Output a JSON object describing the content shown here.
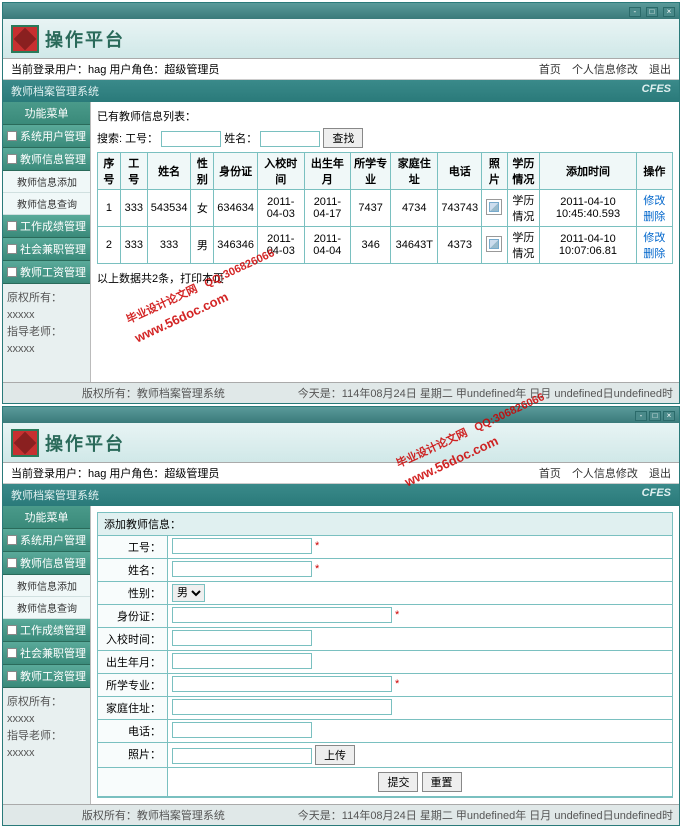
{
  "app": {
    "name": "操作平台",
    "cfes": "CFES"
  },
  "userbar": {
    "current": "当前登录用户：hag  用户角色：超级管理员",
    "home": "首页",
    "profile": "个人信息修改",
    "logout": "退出"
  },
  "subtitle": "教师档案管理系统",
  "sidebar": {
    "header": "功能菜单",
    "items": [
      "系统用户管理",
      "教师信息管理",
      "工作成绩管理",
      "社会兼职管理",
      "教师工资管理"
    ],
    "subs": [
      "教师信息添加",
      "教师信息查询"
    ],
    "info1_label": "原权所有：",
    "info1_val": "xxxxx",
    "info2_label": "指导老师：",
    "info2_val": "xxxxx"
  },
  "list": {
    "title": "已有教师信息列表：",
    "search_label": "搜索: 工号：",
    "name_label": "姓名：",
    "search_btn": "查找",
    "cols": [
      "序号",
      "工号",
      "姓名",
      "性别",
      "身份证",
      "入校时间",
      "出生年月",
      "所学专业",
      "家庭住址",
      "电话",
      "照片",
      "学历情况",
      "添加时间",
      "操作"
    ],
    "rows": [
      {
        "idx": "1",
        "no": "333",
        "name": "543534",
        "sex": "女",
        "idc": "634634",
        "in": "2011-04-03",
        "birth": "2011-04-17",
        "major": "7437",
        "addr": "4734",
        "tel": "743743",
        "edu": "学历情况",
        "time": "2011-04-10 10:45:40.593",
        "op1": "修改",
        "op2": "删除"
      },
      {
        "idx": "2",
        "no": "333",
        "name": "333",
        "sex": "男",
        "idc": "346346",
        "in": "2011-04-03",
        "birth": "2011-04-04",
        "major": "346",
        "addr": "34643T",
        "tel": "4373",
        "edu": "学历情况",
        "time": "2011-04-10 10:07:06.81",
        "op1": "修改",
        "op2": "删除"
      }
    ],
    "summary": "以上数据共2条，打印本页"
  },
  "form": {
    "title": "添加教师信息：",
    "fields": {
      "no": "工号：",
      "name": "姓名：",
      "sex": "性别：",
      "sex_val": "男",
      "idc": "身份证：",
      "in": "入校时间：",
      "birth": "出生年月：",
      "major": "所学专业：",
      "addr": "家庭住址：",
      "tel": "电话：",
      "photo": "照片：",
      "upload": "上传",
      "submit": "提交",
      "reset": "重置"
    }
  },
  "footer": {
    "copy": "版权所有：教师档案管理系统",
    "date": "今天是：114年08月24日 星期二 甲undefined年 日月 undefined日undefined时"
  },
  "watermark": {
    "text": "毕业设计论文网",
    "qq": "QQ:306826066",
    "url": "www.56doc.com"
  }
}
